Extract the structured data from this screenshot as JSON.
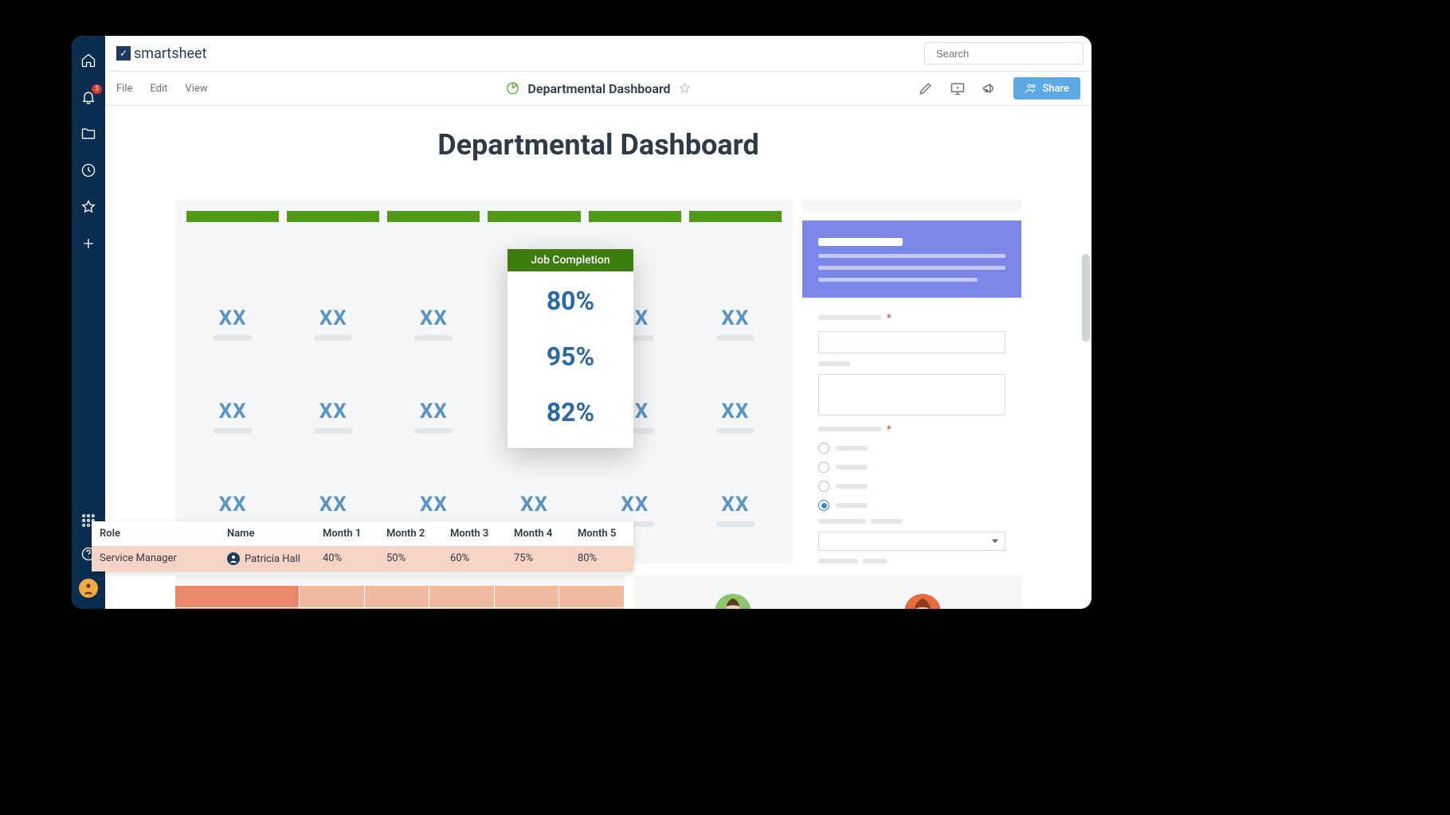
{
  "brand": "smartsheet",
  "search": {
    "placeholder": "Search"
  },
  "notifications": {
    "count": "3"
  },
  "menu": {
    "file": "File",
    "edit": "Edit",
    "view": "View"
  },
  "sheet": {
    "title": "Departmental Dashboard"
  },
  "share_label": "Share",
  "page_heading": "Departmental Dashboard",
  "placeholder_value": "XX",
  "popup": {
    "title": "Job Completion",
    "v1": "80%",
    "v2": "95%",
    "v3": "82%"
  },
  "table": {
    "headers": {
      "role": "Role",
      "name": "Name",
      "m1": "Month 1",
      "m2": "Month 2",
      "m3": "Month 3",
      "m4": "Month 4",
      "m5": "Month 5"
    },
    "row": {
      "role": "Service Manager",
      "name": "Patricia Hall",
      "m1": "40%",
      "m2": "50%",
      "m3": "60%",
      "m4": "75%",
      "m5": "80%"
    }
  }
}
